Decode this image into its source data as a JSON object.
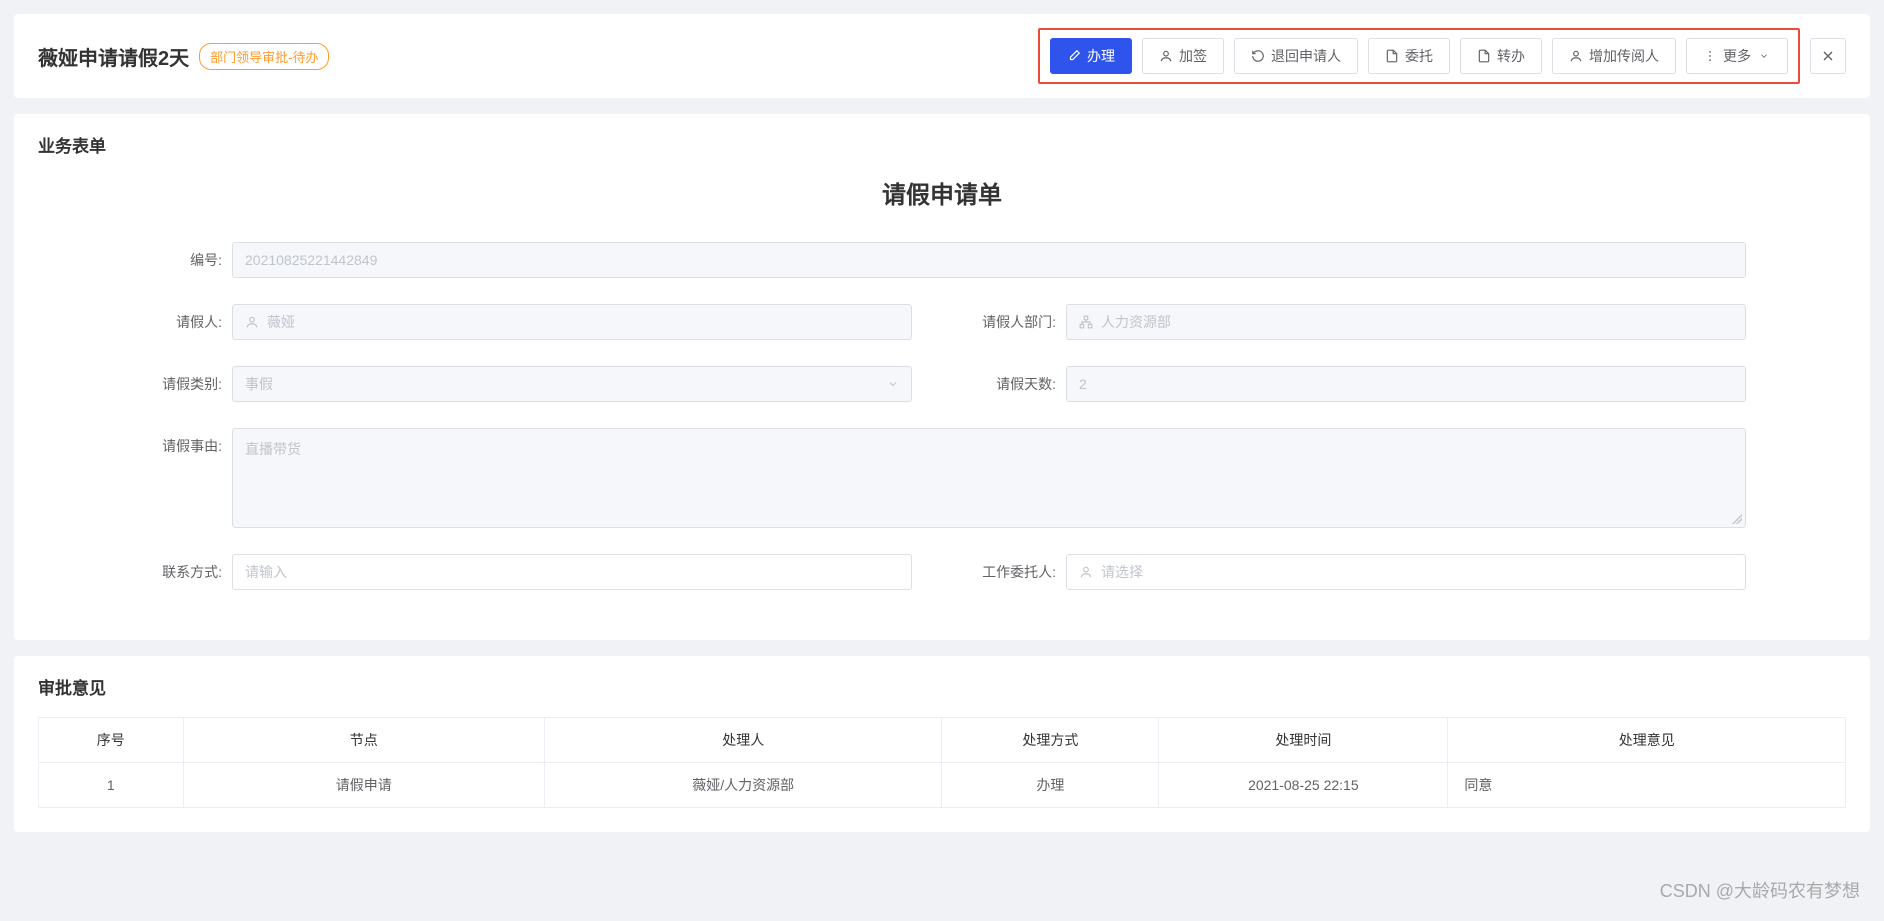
{
  "header": {
    "title": "薇娅申请请假2天",
    "status_badge": "部门领导审批-待办",
    "buttons": {
      "process": "办理",
      "countersign": "加签",
      "return": "退回申请人",
      "delegate": "委托",
      "transfer": "转办",
      "add_reader": "增加传阅人",
      "more": "更多"
    }
  },
  "panel_form": {
    "title": "业务表单",
    "subtitle": "请假申请单",
    "labels": {
      "number": "编号:",
      "applicant": "请假人:",
      "department": "请假人部门:",
      "type": "请假类别:",
      "days": "请假天数:",
      "reason": "请假事由:",
      "contact": "联系方式:",
      "delegate_to": "工作委托人:"
    },
    "values": {
      "number": "20210825221442849",
      "applicant": "薇娅",
      "department": "人力资源部",
      "type": "事假",
      "days": "2",
      "reason": "直播带货",
      "contact_placeholder": "请输入",
      "delegate_placeholder": "请选择"
    }
  },
  "panel_approval": {
    "title": "审批意见",
    "columns": {
      "seq": "序号",
      "node": "节点",
      "handler": "处理人",
      "method": "处理方式",
      "time": "处理时间",
      "opinion": "处理意见"
    },
    "rows": [
      {
        "seq": "1",
        "node": "请假申请",
        "handler": "薇娅/人力资源部",
        "method": "办理",
        "time": "2021-08-25 22:15",
        "opinion": "同意"
      }
    ]
  },
  "watermark": "CSDN @大龄码农有梦想"
}
